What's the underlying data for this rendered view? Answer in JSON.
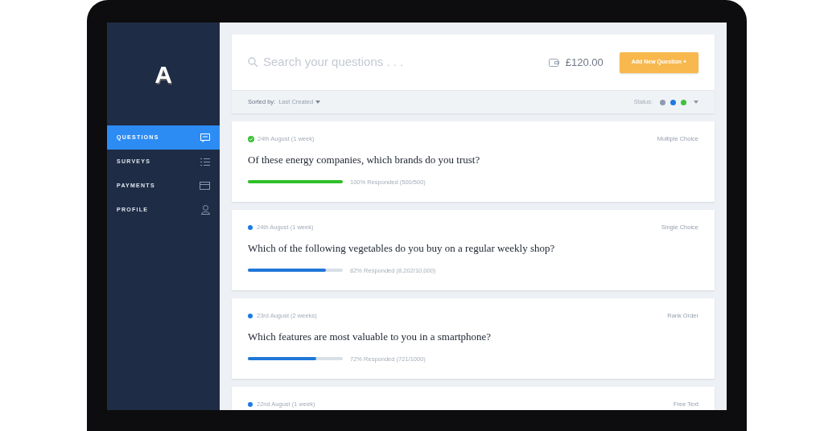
{
  "sidebar": {
    "logo": "A",
    "items": [
      {
        "label": "QUESTIONS",
        "kind": "message",
        "selected": true
      },
      {
        "label": "SURVEYS",
        "kind": "list",
        "selected": false
      },
      {
        "label": "PAYMENTS",
        "kind": "card",
        "selected": false
      },
      {
        "label": "PROFILE",
        "kind": "user",
        "selected": false
      }
    ]
  },
  "header": {
    "search": {
      "placeholder": "Search your questions . . ."
    },
    "balance": "£120.00",
    "add_button": "Add New Question +"
  },
  "filter_bar": {
    "sort_label": "Sorted by:",
    "sort_value": "Last Created",
    "status_label": "Status:",
    "status_filters": [
      {
        "color": "#8d9bb0"
      },
      {
        "color": "#1e7be0"
      },
      {
        "color": "#3ec23a"
      }
    ]
  },
  "questions": [
    {
      "kind": "complete",
      "date": "24th August (1 week)",
      "type": "Multiple Choice",
      "title": "Of these energy companies, which brands do you trust?",
      "level": 1.0,
      "progress": "100% Responded (500/500)"
    },
    {
      "kind": "active",
      "date": "24th August (1 week)",
      "type": "Single Choice",
      "title": "Which of the following vegetables do you buy on a regular weekly shop?",
      "level": 0.82,
      "progress": "82% Responded (8,202/10,000)"
    },
    {
      "kind": "active",
      "date": "23rd August (2 weeks)",
      "type": "Rank Order",
      "title": "Which features are most valuable to you in a smartphone?",
      "level": 0.72,
      "progress": "72% Responded (721/1000)"
    },
    {
      "kind": "active",
      "date": "22nd August (1 week)",
      "type": "Free Text"
    }
  ]
}
